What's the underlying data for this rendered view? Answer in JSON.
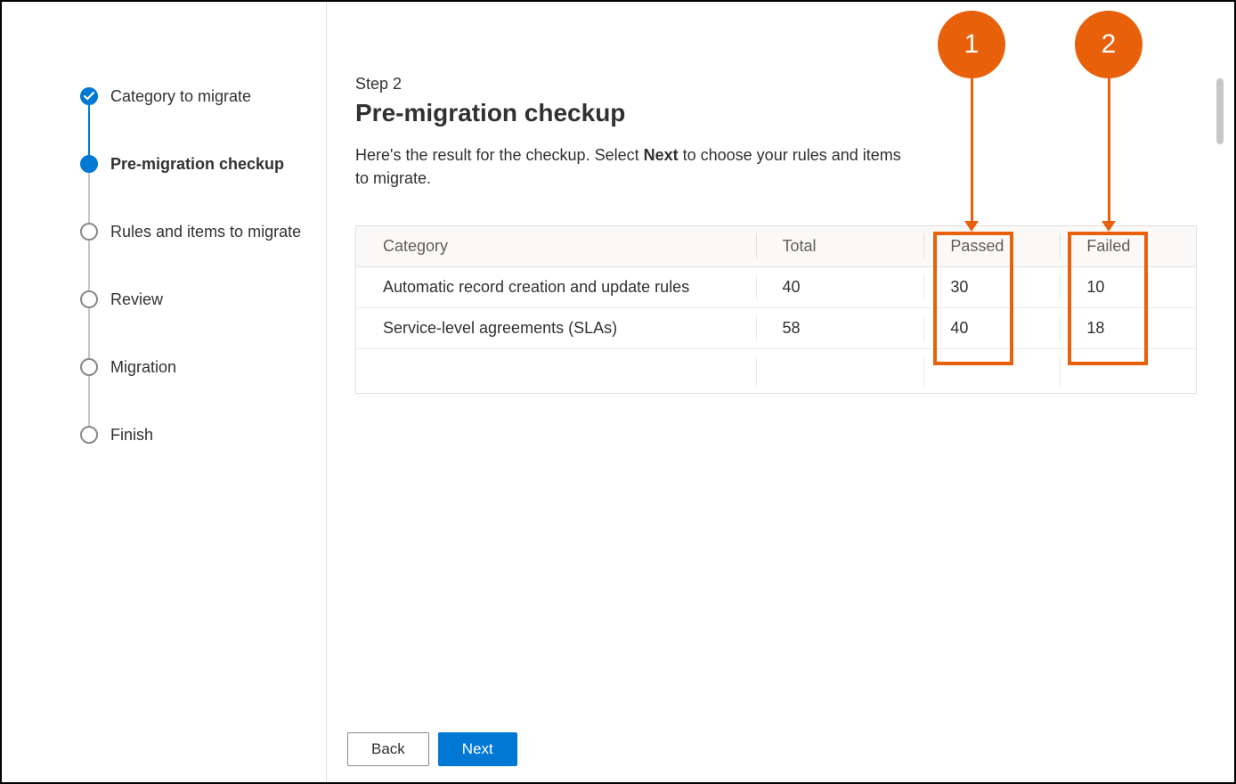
{
  "sidebar": {
    "steps": [
      {
        "label": "Category to migrate",
        "state": "done"
      },
      {
        "label": "Pre-migration checkup",
        "state": "current"
      },
      {
        "label": "Rules and items to migrate",
        "state": "upcoming"
      },
      {
        "label": "Review",
        "state": "upcoming"
      },
      {
        "label": "Migration",
        "state": "upcoming"
      },
      {
        "label": "Finish",
        "state": "upcoming"
      }
    ]
  },
  "main": {
    "step_num": "Step 2",
    "title": "Pre-migration checkup",
    "desc_1": "Here's the result for the checkup. Select ",
    "desc_bold": "Next",
    "desc_2": " to choose your rules and items to migrate.",
    "table": {
      "headers": {
        "category": "Category",
        "total": "Total",
        "passed": "Passed",
        "failed": "Failed"
      },
      "rows": [
        {
          "category": "Automatic record creation and update rules",
          "total": "40",
          "passed": "30",
          "failed": "10"
        },
        {
          "category": "Service-level agreements (SLAs)",
          "total": "58",
          "passed": "40",
          "failed": "18"
        }
      ]
    }
  },
  "footer": {
    "back": "Back",
    "next": "Next"
  },
  "callouts": {
    "c1": "1",
    "c2": "2"
  },
  "colors": {
    "accent": "#0078d4",
    "callout": "#e8610a"
  }
}
